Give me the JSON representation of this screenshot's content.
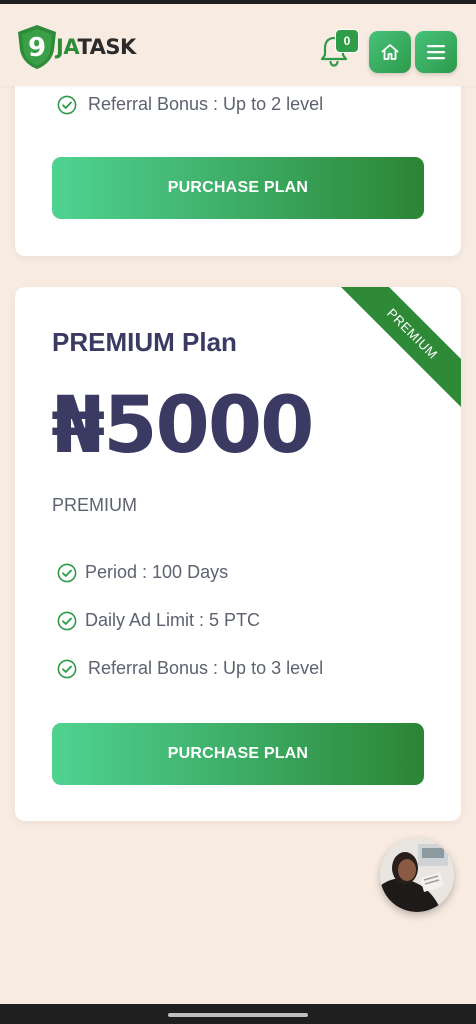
{
  "header": {
    "logo_digit": "9",
    "logo_ja": "JA",
    "logo_task": "TASK",
    "notification_count": "0"
  },
  "top_card": {
    "features": [
      {
        "label": "Referral Bonus : Up to 2 level"
      }
    ],
    "button_label": "PURCHASE PLAN"
  },
  "premium_card": {
    "title": "PREMIUM Plan",
    "price": "₦5000",
    "subtitle": "PREMIUM",
    "ribbon": "PREMIUM",
    "features": [
      {
        "label": "Period : 100 Days"
      },
      {
        "label": "Daily Ad Limit : 5 PTC"
      },
      {
        "label": "Referral Bonus : Up to 3 level"
      }
    ],
    "button_label": "PURCHASE PLAN"
  },
  "colors": {
    "background": "#f8ebe1",
    "brand_green": "#2e8b3a",
    "title_navy": "#3b3a63"
  },
  "icons": {
    "bell": "bell-icon",
    "home": "home-icon",
    "menu": "menu-icon",
    "check": "check-circle-icon"
  }
}
